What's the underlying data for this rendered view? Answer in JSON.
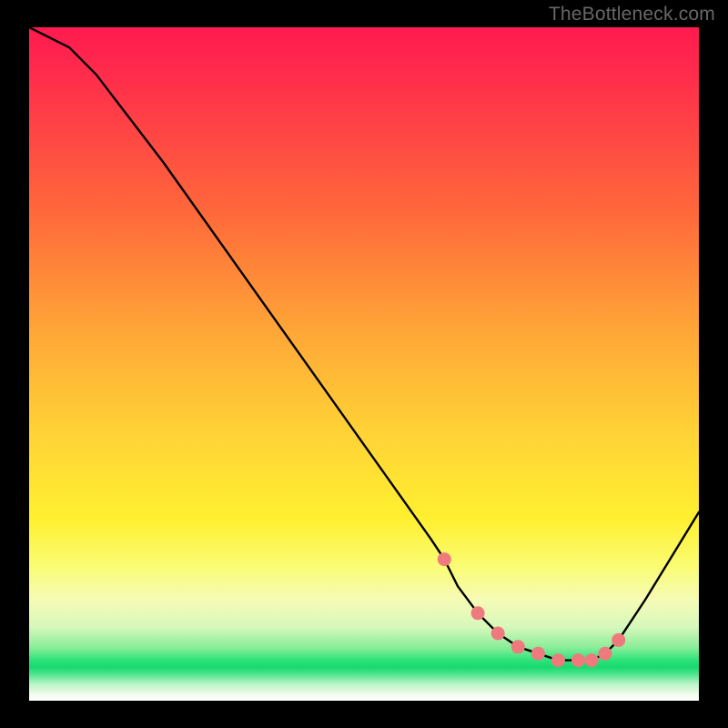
{
  "watermark": "TheBottleneck.com",
  "chart_data": {
    "type": "line",
    "title": "",
    "xlabel": "",
    "ylabel": "",
    "xlim": [
      0,
      100
    ],
    "ylim": [
      0,
      100
    ],
    "series": [
      {
        "name": "bottleneck-curve",
        "x": [
          0,
          6,
          10,
          20,
          30,
          40,
          50,
          60,
          62,
          64,
          67,
          70,
          73,
          76,
          79,
          82,
          84,
          86,
          88,
          92,
          100
        ],
        "values": [
          100,
          97,
          93,
          80,
          66,
          52,
          38,
          24,
          21,
          17,
          13,
          10,
          8,
          7,
          6,
          6,
          6,
          7,
          9,
          15,
          28
        ]
      }
    ],
    "markers": {
      "name": "highlight-points",
      "x": [
        62,
        67,
        70,
        73,
        76,
        79,
        82,
        84,
        86,
        88
      ],
      "values": [
        21,
        13,
        10,
        8,
        7,
        6,
        6,
        6,
        7,
        9
      ]
    },
    "gradient_stops": [
      {
        "pos": 0,
        "color": "#ff1a4f"
      },
      {
        "pos": 28,
        "color": "#ff6a3a"
      },
      {
        "pos": 60,
        "color": "#ffd236"
      },
      {
        "pos": 80,
        "color": "#fafc73"
      },
      {
        "pos": 94,
        "color": "#2de37a"
      },
      {
        "pos": 100,
        "color": "#ffffff"
      }
    ]
  }
}
